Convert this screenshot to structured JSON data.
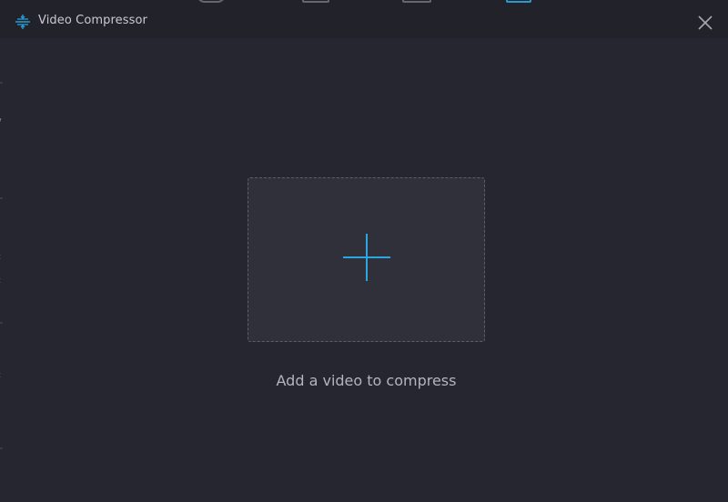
{
  "window": {
    "title": "Video Compressor",
    "title_icon": "compress-icon",
    "close_icon": "close-icon"
  },
  "drop_zone": {
    "icon": "plus-icon",
    "hint": "Add a video to compress"
  },
  "colors": {
    "background": "#262630",
    "titlebar": "#22222b",
    "drop_zone_fill": "#30303b",
    "drop_zone_border": "#5d5e69",
    "accent": "#2aa6e0",
    "title_text": "#c8cad2",
    "hint_text": "#b3b5bd"
  }
}
